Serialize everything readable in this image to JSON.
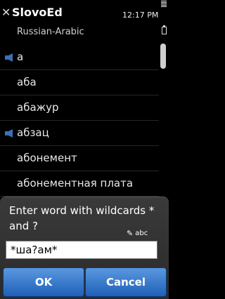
{
  "statusbar": {
    "app_title": "SlovoEd",
    "time": "12:17 PM",
    "close_glyph": "✕"
  },
  "dictionary": {
    "name": "Russian-Arabic"
  },
  "list": {
    "items": [
      {
        "word": "а",
        "has_audio": true
      },
      {
        "word": "аба",
        "has_audio": false
      },
      {
        "word": "абажур",
        "has_audio": false
      },
      {
        "word": "абзац",
        "has_audio": true
      },
      {
        "word": "абонемент",
        "has_audio": false
      },
      {
        "word": "абонементная плата",
        "has_audio": false
      }
    ]
  },
  "dialog": {
    "prompt": "Enter word with wildcards * and ?",
    "input_mode": "abc",
    "input_value": "*ша?ам*",
    "ok_label": "OK",
    "cancel_label": "Cancel"
  },
  "icons": {
    "speaker": "speaker-icon",
    "pen": "pen-icon"
  },
  "colors": {
    "background": "#000000",
    "button_top": "#5a98e0",
    "button_bottom": "#1f60b8",
    "speaker": "#3d6fb5"
  }
}
